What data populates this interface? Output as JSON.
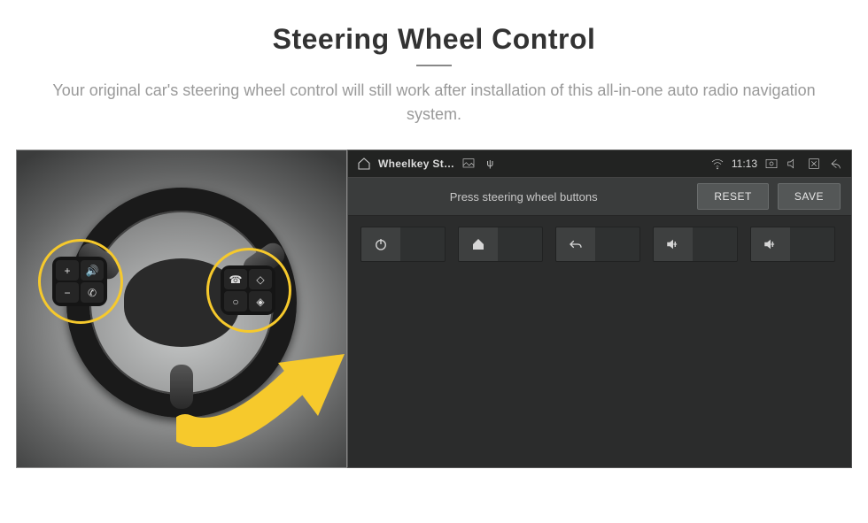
{
  "header": {
    "title": "Steering Wheel Control",
    "subtitle": "Your original car's steering wheel control will still work after installation of this all-in-one auto radio navigation system."
  },
  "status_bar": {
    "app_label": "Wheelkey St…",
    "time": "11:13",
    "icons": {
      "home": "home-icon",
      "image": "image-icon",
      "psi": "usb-icon",
      "wifi": "wifi-icon",
      "screenshot": "capture-icon",
      "mute": "mute-icon",
      "close": "close-app-icon",
      "back": "back-icon"
    }
  },
  "action_row": {
    "prompt": "Press steering wheel buttons",
    "reset_label": "RESET",
    "save_label": "SAVE"
  },
  "keys": [
    {
      "name": "power",
      "icon": "power-icon"
    },
    {
      "name": "home",
      "icon": "home-fill-icon"
    },
    {
      "name": "back",
      "icon": "return-icon"
    },
    {
      "name": "volume-up-1",
      "icon": "volume-up-icon"
    },
    {
      "name": "volume-up-2",
      "icon": "volume-up-icon"
    }
  ],
  "wheel_pad": {
    "left": [
      "+",
      "🔊",
      "−",
      "✆"
    ],
    "right": [
      "☎",
      "◇",
      "○",
      "◈"
    ]
  },
  "colors": {
    "accent_yellow": "#f6c92c",
    "panel_dark": "#2d2f2f",
    "btn_gray": "#545757"
  }
}
